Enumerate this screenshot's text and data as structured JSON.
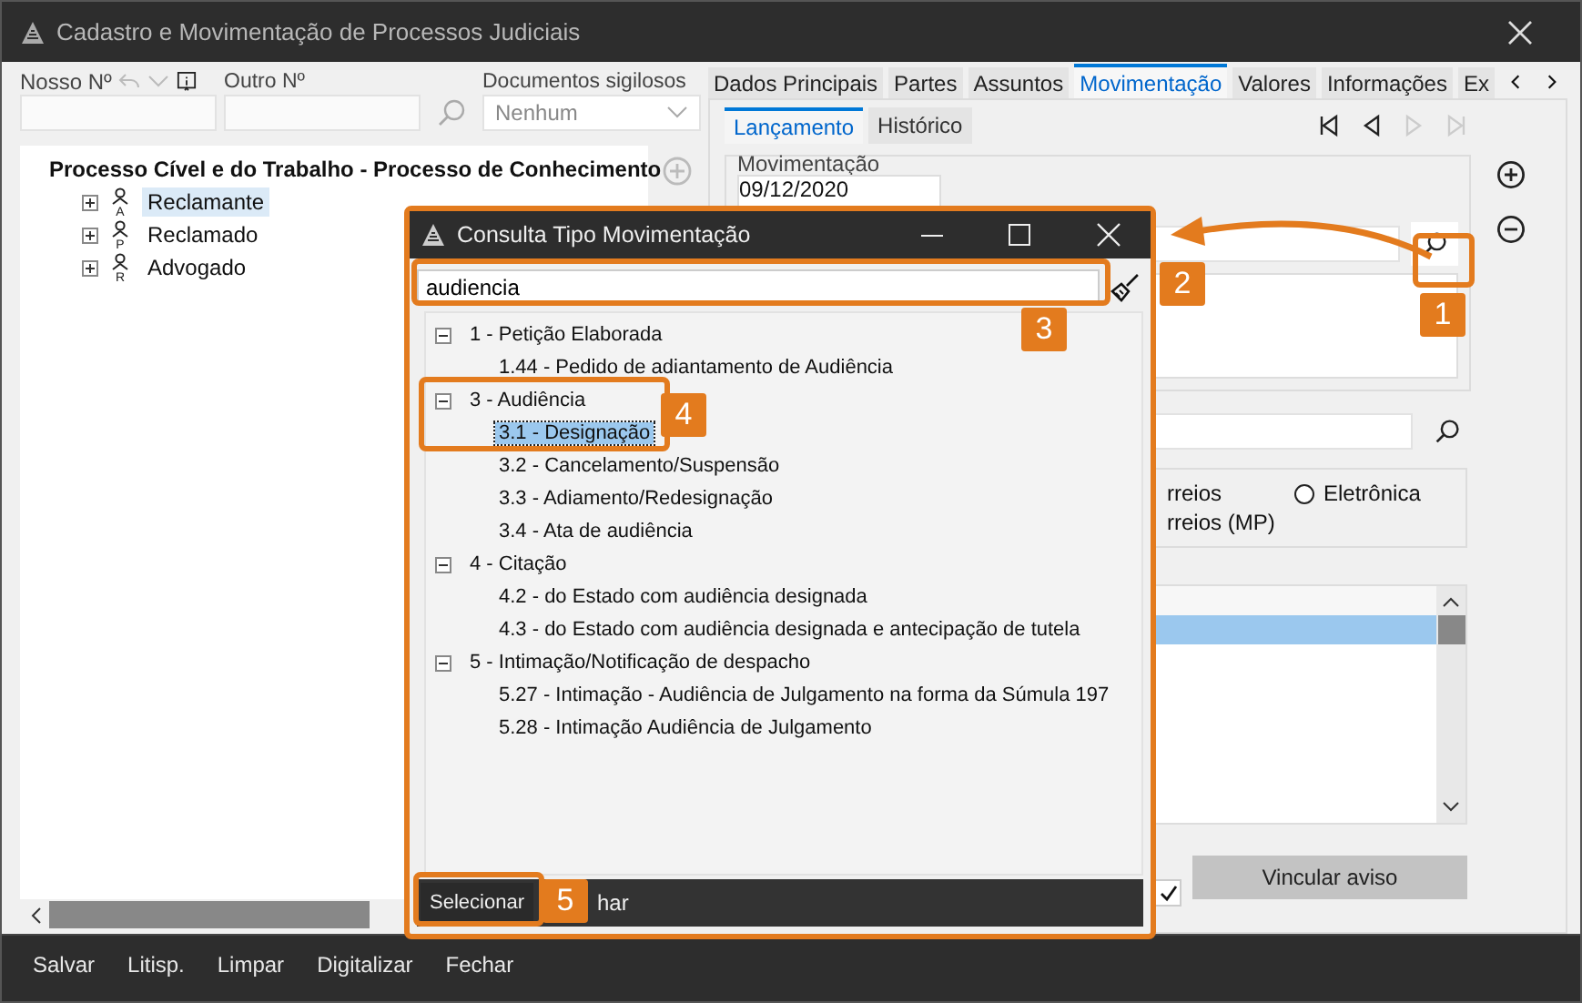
{
  "window": {
    "title": "Cadastro e Movimentação de Processos Judiciais"
  },
  "header": {
    "our_number_label": "Nosso Nº",
    "other_number_label": "Outro Nº",
    "confidential_label": "Documentos sigilosos",
    "confidential_value": "Nenhum"
  },
  "process_tree": {
    "root": "Processo Cível e do Trabalho - Processo de Conhecimento",
    "children": [
      {
        "label": "Reclamante",
        "icon_letter": "A",
        "selected": true
      },
      {
        "label": "Reclamado",
        "icon_letter": "P",
        "selected": false
      },
      {
        "label": "Advogado",
        "icon_letter": "R",
        "selected": false
      }
    ]
  },
  "tabs": [
    {
      "label": "Dados Principais",
      "selected": false
    },
    {
      "label": "Partes",
      "selected": false
    },
    {
      "label": "Assuntos",
      "selected": false
    },
    {
      "label": "Movimentação",
      "selected": true
    },
    {
      "label": "Valores",
      "selected": false
    },
    {
      "label": "Informações",
      "selected": false
    },
    {
      "label": "Ex",
      "selected": false
    }
  ],
  "subtabs": [
    {
      "label": "Lançamento",
      "selected": true
    },
    {
      "label": "Histórico",
      "selected": false
    }
  ],
  "record_nav": [
    {
      "kind": "first",
      "disabled": false
    },
    {
      "kind": "prev",
      "disabled": false
    },
    {
      "kind": "next",
      "disabled": true
    },
    {
      "kind": "last",
      "disabled": true
    }
  ],
  "movement": {
    "label": "Movimentação",
    "date": "09/12/2020"
  },
  "delivery": [
    {
      "kind": "text",
      "label": "rreios"
    },
    {
      "kind": "radio",
      "label": "Eletrônica",
      "selected": false
    },
    {
      "kind": "text",
      "label": "rreios (MP)"
    }
  ],
  "notices": {
    "rows": [
      {
        "selected": true
      }
    ]
  },
  "link_notice": {
    "checked": true,
    "button": "Vincular aviso"
  },
  "footer_menu": [
    "Salvar",
    "Litisp.",
    "Limpar",
    "Digitalizar",
    "Fechar"
  ],
  "dialog": {
    "title": "Consulta Tipo Movimentação",
    "search_value": "audiencia",
    "tree": [
      {
        "label": "1 - Petição Elaborada",
        "expanded": true,
        "children": [
          {
            "label": "1.44 - Pedido de adiantamento de Audiência",
            "selected": false
          }
        ]
      },
      {
        "label": "3 - Audiência",
        "expanded": true,
        "children": [
          {
            "label": "3.1 - Designação",
            "selected": true
          },
          {
            "label": "3.2 - Cancelamento/Suspensão",
            "selected": false
          },
          {
            "label": "3.3 - Adiamento/Redesignação",
            "selected": false
          },
          {
            "label": "3.4 - Ata de audiência",
            "selected": false
          }
        ]
      },
      {
        "label": "4 - Citação",
        "expanded": true,
        "children": [
          {
            "label": "4.2 - do Estado com audiência designada",
            "selected": false
          },
          {
            "label": "4.3 - do Estado com audiência designada e antecipação de tutela",
            "selected": false
          }
        ]
      },
      {
        "label": "5 - Intimação/Notificação de despacho",
        "expanded": true,
        "children": [
          {
            "label": "5.27 - Intimação - Audiência de Julgamento na forma da Súmula 197",
            "selected": false
          },
          {
            "label": "5.28 - Intimação Audiência de Julgamento",
            "selected": false
          }
        ]
      }
    ],
    "buttons": [
      {
        "label": "Selecionar"
      },
      {
        "label": "har"
      }
    ]
  },
  "callouts": [
    "1",
    "2",
    "3",
    "4",
    "5"
  ]
}
